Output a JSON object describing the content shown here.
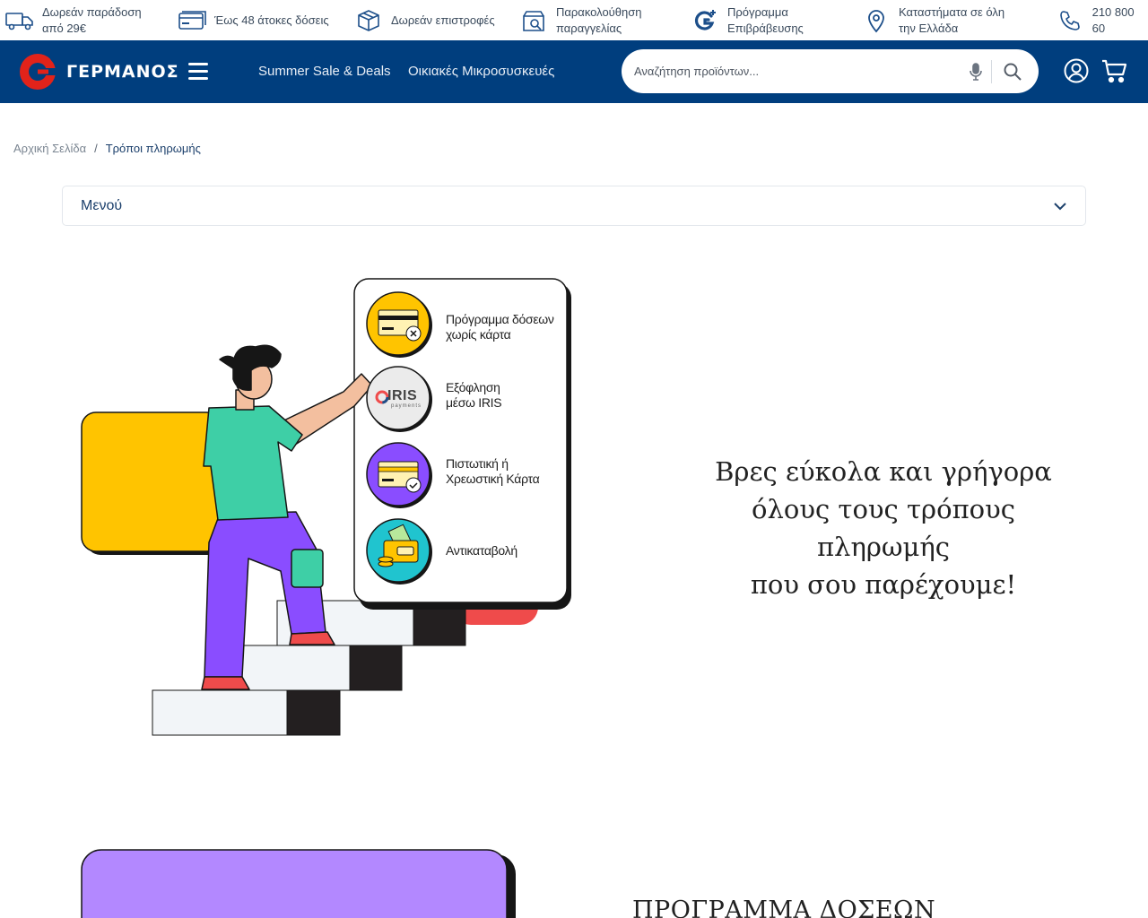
{
  "info_bar": {
    "items": [
      {
        "icon": "delivery-truck-icon",
        "lines": [
          "Δωρεάν παράδοση",
          "από 29€"
        ]
      },
      {
        "icon": "credit-card-icon",
        "lines": [
          "Έως 48 άτοκες δόσεις"
        ]
      },
      {
        "icon": "box-return-icon",
        "lines": [
          "Δωρεάν επιστροφές"
        ]
      },
      {
        "icon": "order-tracking-icon",
        "lines": [
          "Παρακολούθηση",
          "παραγγελίας"
        ]
      },
      {
        "icon": "rewards-program-icon",
        "lines": [
          "Πρόγραμμα",
          "Επιβράβευσης"
        ]
      },
      {
        "icon": "store-location-icon",
        "lines": [
          "Καταστήματα σε όλη",
          "την Ελλάδα"
        ]
      },
      {
        "icon": "phone-icon",
        "lines": [
          "210 800 60"
        ]
      }
    ]
  },
  "header": {
    "logo_text": "ΓΕΡΜΑΝΟΣ",
    "nav": [
      "Summer Sale & Deals",
      "Οικιακές Μικροσυσκευές"
    ],
    "search_placeholder": "Αναζήτηση προϊόντων...",
    "colors": {
      "primary": "#003e7e",
      "logo_red": "#e2231a"
    }
  },
  "breadcrumb": {
    "home": "Αρχική Σελίδα",
    "separator": "/",
    "current": "Τρόποι πληρωμής"
  },
  "menu_dropdown": {
    "label": "Μενού"
  },
  "hero": {
    "payment_options": [
      {
        "label_lines": [
          "Πρόγραμμα δόσεων",
          "χωρίς κάρτα"
        ],
        "color": "#ffc400",
        "icon": "card-no-icon"
      },
      {
        "label_lines": [
          "Εξόφληση",
          "μέσω IRIS"
        ],
        "color": "#ebebeb",
        "icon": "iris-logo-icon",
        "logo_text": "IRIS",
        "logo_sub": "payments"
      },
      {
        "label_lines": [
          "Πιστωτική ή",
          "Χρεωστική Κάρτα"
        ],
        "color": "#8a4dff",
        "icon": "card-check-icon"
      },
      {
        "label_lines": [
          "Αντικαταβολή"
        ],
        "color": "#20c4cf",
        "icon": "cash-wallet-icon"
      }
    ],
    "title_lines": [
      "Βρες εύκολα και γρήγορα",
      "όλους τους τρόπους πληρωμής",
      "που σου παρέχουμε!"
    ]
  },
  "next_section": {
    "title": "ΠΡΟΓΡΑΜΜΑ ΔΟΣΕΩΝ",
    "card_color": "#b388ff"
  }
}
